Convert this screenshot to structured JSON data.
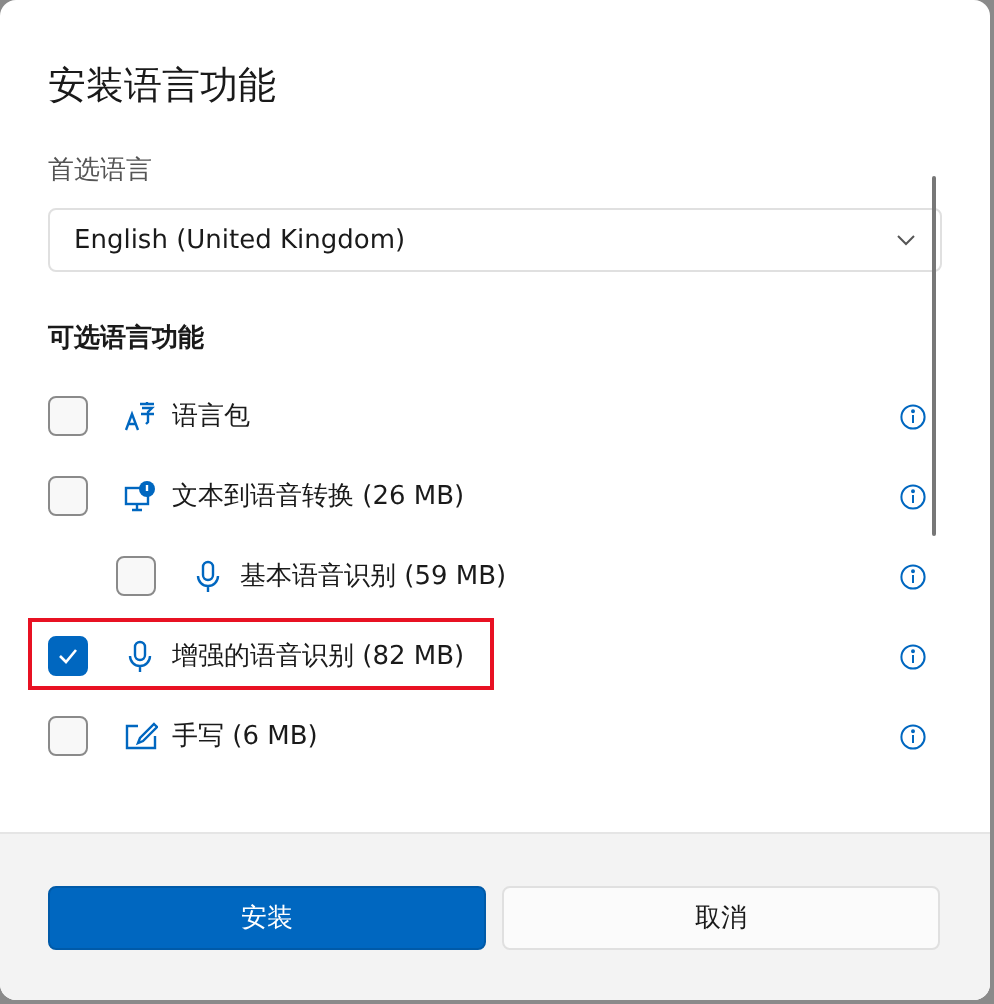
{
  "dialog": {
    "title": "安装语言功能",
    "preferred_label": "首选语言",
    "dropdown": {
      "value": "English (United Kingdom)"
    },
    "section_title": "可选语言功能",
    "features": [
      {
        "kind": "language",
        "label": "语言包",
        "checked": false,
        "highlighted": false
      },
      {
        "kind": "speech",
        "label": "文本到语音转换 (26 MB)",
        "checked": false,
        "highlighted": false,
        "children": [
          {
            "kind": "mic",
            "label": "基本语音识别 (59 MB)",
            "checked": false,
            "highlighted": false
          }
        ]
      },
      {
        "kind": "mic",
        "label": "增强的语音识别 (82 MB)",
        "checked": true,
        "highlighted": true
      },
      {
        "kind": "handwriting",
        "label": "手写 (6 MB)",
        "checked": false,
        "highlighted": false
      }
    ],
    "buttons": [
      {
        "label": "安装",
        "kind": "primary"
      },
      {
        "label": "取消",
        "kind": "secondary"
      }
    ]
  }
}
